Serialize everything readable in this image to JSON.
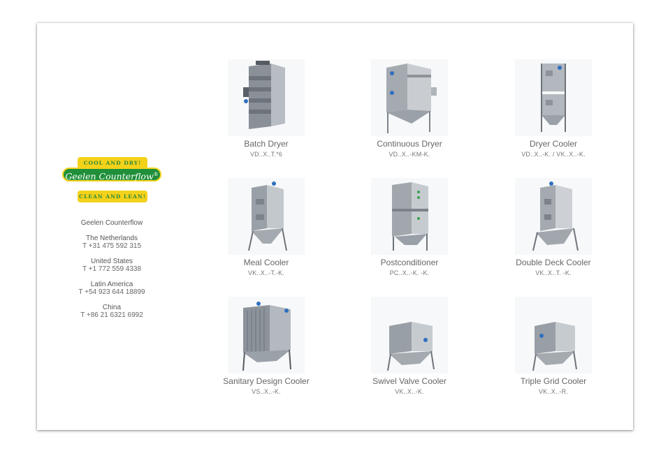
{
  "logo": {
    "top_band": "COOL AND DRY!",
    "brand": "Geelen Counterflow",
    "registered": "®",
    "bottom_band": "CLEAN AND LEAN!"
  },
  "contacts": {
    "company": "Geelen Counterflow",
    "offices": [
      {
        "region": "The Netherlands",
        "phone": "T +31 475 592 315"
      },
      {
        "region": "United States",
        "phone": "T +1 772 559 4338"
      },
      {
        "region": "Latin America",
        "phone": "T +54 923 644 18899"
      },
      {
        "region": "China",
        "phone": "T +86 21 6321 6992"
      }
    ]
  },
  "products": [
    {
      "name": "Batch Dryer",
      "code": "VD..X..T.*6"
    },
    {
      "name": "Continuous Dryer",
      "code": "VD..X..-KM-K."
    },
    {
      "name": "Dryer Cooler",
      "code": "VD..X..-K. / VK..X..-K."
    },
    {
      "name": "Meal Cooler",
      "code": "VK..X..-T.-K."
    },
    {
      "name": "Postconditioner",
      "code": "PC..X..-K. -K."
    },
    {
      "name": "Double Deck Cooler",
      "code": "VK..X..T. -K."
    },
    {
      "name": "Sanitary Design Cooler",
      "code": "VS..X..-K."
    },
    {
      "name": "Swivel Valve Cooler",
      "code": "VK..X..-K."
    },
    {
      "name": "Triple Grid Cooler",
      "code": "VK..X..-R."
    }
  ],
  "colors": {
    "logo_yellow": "#f4d21a",
    "logo_green": "#1f8f3a",
    "text_gray": "#666666"
  }
}
